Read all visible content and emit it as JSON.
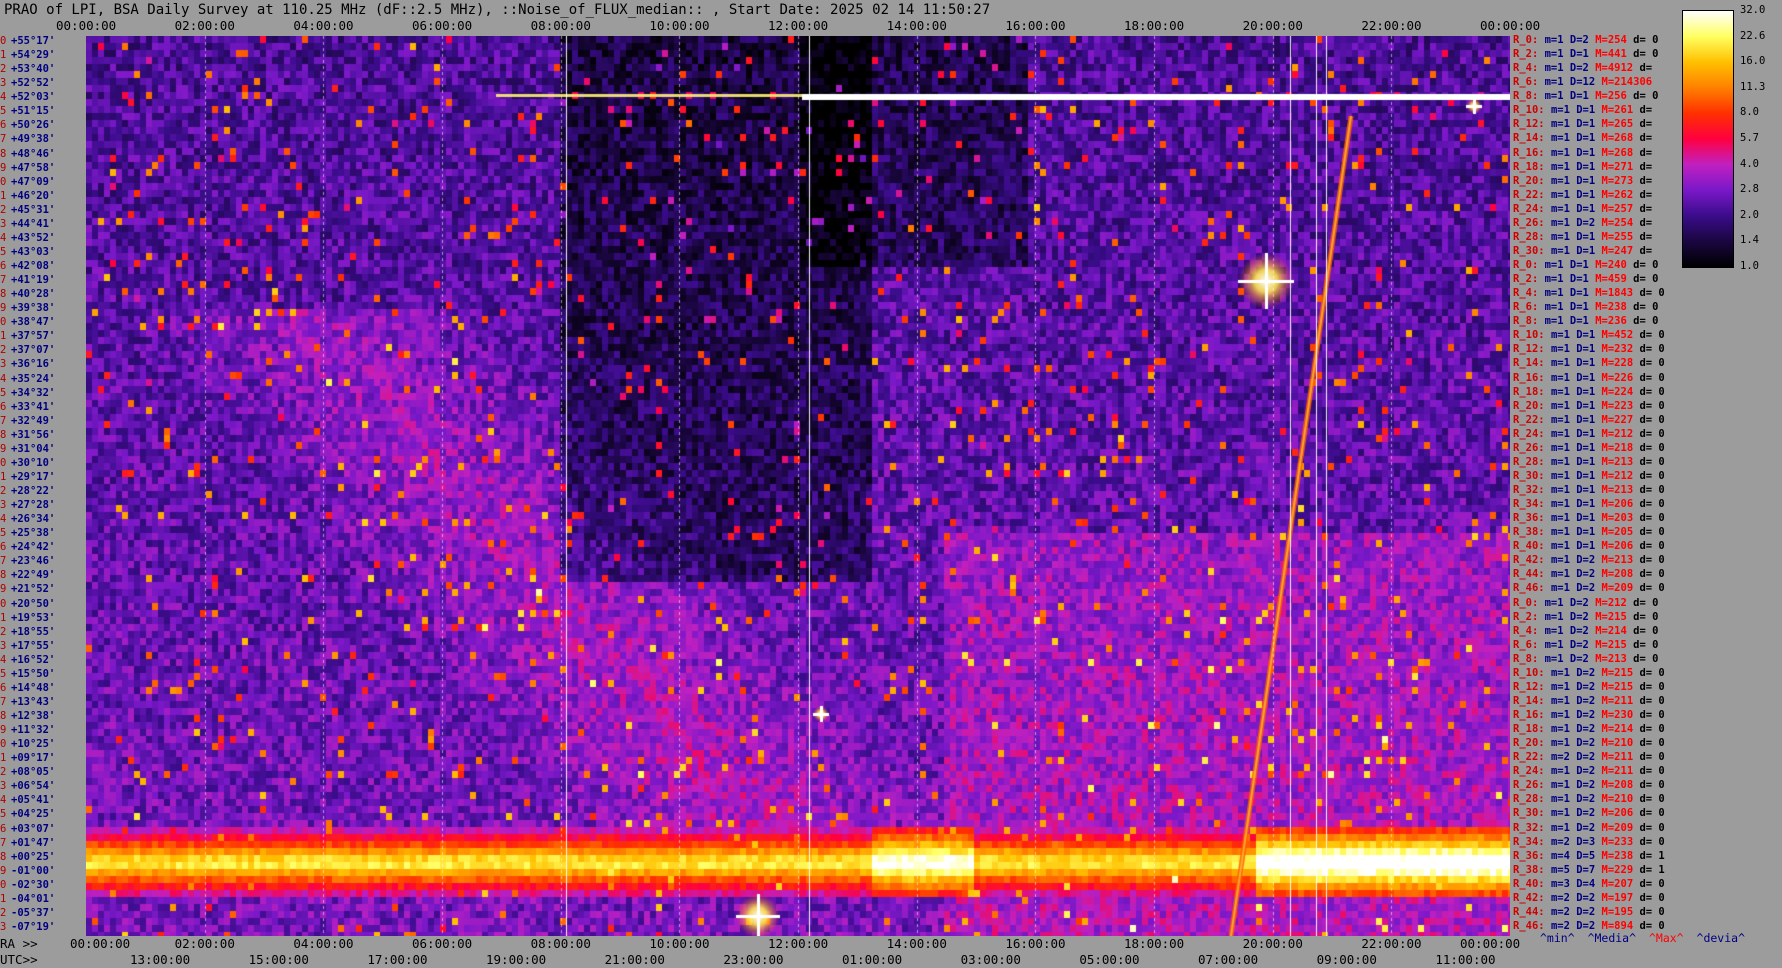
{
  "title": "PRAO of LPI, BSA Daily Survey at 110.25 MHz (dF::2.5 MHz), ::Noise_of_FLUX_median:: , Start Date: 2025 02 14 11:50:27",
  "chart_data": {
    "type": "heatmap",
    "title": "PRAO of LPI, BSA Daily Survey at 110.25 MHz (dF::2.5 MHz), ::Noise_of_FLUX_median:: , Start Date: 2025 02 14 11:50:27",
    "x_top_ticks": [
      "00:00:00",
      "02:00:00",
      "04:00:00",
      "06:00:00",
      "08:00:00",
      "10:00:00",
      "12:00:00",
      "14:00:00",
      "16:00:00",
      "18:00:00",
      "20:00:00",
      "22:00:00",
      "00:00:00"
    ],
    "ra_axis_label": "RA >>",
    "ra_ticks": [
      "00:00:00",
      "02:00:00",
      "04:00:00",
      "06:00:00",
      "08:00:00",
      "10:00:00",
      "12:00:00",
      "14:00:00",
      "16:00:00",
      "18:00:00",
      "20:00:00",
      "22:00:00",
      "00:00:00"
    ],
    "utc_axis_label": "UTC>>",
    "utc_ticks": [
      "13:00:00",
      "15:00:00",
      "17:00:00",
      "19:00:00",
      "21:00:00",
      "23:00:00",
      "01:00:00",
      "03:00:00",
      "05:00:00",
      "07:00:00",
      "09:00:00",
      "11:00:00"
    ],
    "dec_labels": [
      "+55°17'",
      "+54°29'",
      "+53°40'",
      "+52°52'",
      "+52°03'",
      "+51°15'",
      "+50°26'",
      "+49°38'",
      "+48°46'",
      "+47°58'",
      "+47°09'",
      "+46°20'",
      "+45°31'",
      "+44°41'",
      "+43°52'",
      "+43°03'",
      "+42°08'",
      "+41°19'",
      "+40°28'",
      "+39°38'",
      "+38°47'",
      "+37°57'",
      "+37°07'",
      "+36°16'",
      "+35°24'",
      "+34°32'",
      "+33°41'",
      "+32°49'",
      "+31°56'",
      "+31°04'",
      "+30°10'",
      "+29°17'",
      "+28°22'",
      "+27°28'",
      "+26°34'",
      "+25°38'",
      "+24°42'",
      "+23°46'",
      "+22°49'",
      "+21°52'",
      "+20°50'",
      "+19°53'",
      "+18°55'",
      "+17°55'",
      "+16°52'",
      "+15°50'",
      "+14°48'",
      "+13°43'",
      "+12°38'",
      "+11°32'",
      "+10°25'",
      "+09°17'",
      "+08°05'",
      "+06°54'",
      "+05°41'",
      "+04°25'",
      "+03°07'",
      "+01°47'",
      "+00°25'",
      "-01°00'",
      "-02°30'",
      "-04°01'",
      "-05°37'",
      "-07°19'"
    ],
    "colorbar": {
      "ticks": [
        "32.0",
        "22.6",
        "16.0",
        "11.3",
        "8.0",
        "5.7",
        "4.0",
        "2.8",
        "2.0",
        "1.4",
        "1.0"
      ],
      "colormap": [
        "#000000",
        "#1a0640",
        "#3a0c8a",
        "#7a18c8",
        "#c020c0",
        "#ff0040",
        "#ff3000",
        "#ff8000",
        "#ffc000",
        "#ffff60",
        "#ffffff"
      ]
    },
    "stat_rows": [
      {
        "r": "R_0:",
        "m": "m=1",
        "d": "D=2",
        "mx": "M=254",
        "dv": "d= 0"
      },
      {
        "r": "R_2:",
        "m": "m=1",
        "d": "D=1",
        "mx": "M=441",
        "dv": "d= 0"
      },
      {
        "r": "R_4:",
        "m": "m=1",
        "d": "D=2",
        "mx": "M=4912",
        "dv": "d="
      },
      {
        "r": "R_6:",
        "m": "m=1",
        "d": "D=12",
        "mx": "M=214306",
        "dv": ""
      },
      {
        "r": "R_8:",
        "m": "m=1",
        "d": "D=1",
        "mx": "M=256",
        "dv": "d= 0"
      },
      {
        "r": "R_10:",
        "m": "m=1",
        "d": "D=1",
        "mx": "M=261",
        "dv": "d="
      },
      {
        "r": "R_12:",
        "m": "m=1",
        "d": "D=1",
        "mx": "M=265",
        "dv": "d="
      },
      {
        "r": "R_14:",
        "m": "m=1",
        "d": "D=1",
        "mx": "M=268",
        "dv": "d="
      },
      {
        "r": "R_16:",
        "m": "m=1",
        "d": "D=1",
        "mx": "M=268",
        "dv": "d="
      },
      {
        "r": "R_18:",
        "m": "m=1",
        "d": "D=1",
        "mx": "M=271",
        "dv": "d="
      },
      {
        "r": "R_20:",
        "m": "m=1",
        "d": "D=1",
        "mx": "M=273",
        "dv": "d="
      },
      {
        "r": "R_22:",
        "m": "m=1",
        "d": "D=1",
        "mx": "M=262",
        "dv": "d="
      },
      {
        "r": "R_24:",
        "m": "m=1",
        "d": "D=1",
        "mx": "M=257",
        "dv": "d="
      },
      {
        "r": "R_26:",
        "m": "m=1",
        "d": "D=2",
        "mx": "M=254",
        "dv": "d="
      },
      {
        "r": "R_28:",
        "m": "m=1",
        "d": "D=1",
        "mx": "M=255",
        "dv": "d="
      },
      {
        "r": "R_30:",
        "m": "m=1",
        "d": "D=1",
        "mx": "M=247",
        "dv": "d="
      },
      {
        "r": "R_0:",
        "m": "m=1",
        "d": "D=1",
        "mx": "M=240",
        "dv": "d= 0"
      },
      {
        "r": "R_2:",
        "m": "m=1",
        "d": "D=1",
        "mx": "M=459",
        "dv": "d= 0"
      },
      {
        "r": "R_4:",
        "m": "m=1",
        "d": "D=1",
        "mx": "M=1843",
        "dv": "d= 0"
      },
      {
        "r": "R_6:",
        "m": "m=1",
        "d": "D=1",
        "mx": "M=238",
        "dv": "d= 0"
      },
      {
        "r": "R_8:",
        "m": "m=1",
        "d": "D=1",
        "mx": "M=236",
        "dv": "d= 0"
      },
      {
        "r": "R_10:",
        "m": "m=1",
        "d": "D=1",
        "mx": "M=452",
        "dv": "d= 0"
      },
      {
        "r": "R_12:",
        "m": "m=1",
        "d": "D=1",
        "mx": "M=232",
        "dv": "d= 0"
      },
      {
        "r": "R_14:",
        "m": "m=1",
        "d": "D=1",
        "mx": "M=228",
        "dv": "d= 0"
      },
      {
        "r": "R_16:",
        "m": "m=1",
        "d": "D=1",
        "mx": "M=226",
        "dv": "d= 0"
      },
      {
        "r": "R_18:",
        "m": "m=1",
        "d": "D=1",
        "mx": "M=224",
        "dv": "d= 0"
      },
      {
        "r": "R_20:",
        "m": "m=1",
        "d": "D=1",
        "mx": "M=223",
        "dv": "d= 0"
      },
      {
        "r": "R_22:",
        "m": "m=1",
        "d": "D=1",
        "mx": "M=227",
        "dv": "d= 0"
      },
      {
        "r": "R_24:",
        "m": "m=1",
        "d": "D=1",
        "mx": "M=212",
        "dv": "d= 0"
      },
      {
        "r": "R_26:",
        "m": "m=1",
        "d": "D=1",
        "mx": "M=218",
        "dv": "d= 0"
      },
      {
        "r": "R_28:",
        "m": "m=1",
        "d": "D=1",
        "mx": "M=213",
        "dv": "d= 0"
      },
      {
        "r": "R_30:",
        "m": "m=1",
        "d": "D=1",
        "mx": "M=212",
        "dv": "d= 0"
      },
      {
        "r": "R_32:",
        "m": "m=1",
        "d": "D=1",
        "mx": "M=213",
        "dv": "d= 0"
      },
      {
        "r": "R_34:",
        "m": "m=1",
        "d": "D=1",
        "mx": "M=206",
        "dv": "d= 0"
      },
      {
        "r": "R_36:",
        "m": "m=1",
        "d": "D=1",
        "mx": "M=203",
        "dv": "d= 0"
      },
      {
        "r": "R_38:",
        "m": "m=1",
        "d": "D=1",
        "mx": "M=205",
        "dv": "d= 0"
      },
      {
        "r": "R_40:",
        "m": "m=1",
        "d": "D=1",
        "mx": "M=206",
        "dv": "d= 0"
      },
      {
        "r": "R_42:",
        "m": "m=1",
        "d": "D=2",
        "mx": "M=213",
        "dv": "d= 0"
      },
      {
        "r": "R_44:",
        "m": "m=1",
        "d": "D=2",
        "mx": "M=208",
        "dv": "d= 0"
      },
      {
        "r": "R_46:",
        "m": "m=1",
        "d": "D=2",
        "mx": "M=209",
        "dv": "d= 0"
      },
      {
        "r": "R_0:",
        "m": "m=1",
        "d": "D=2",
        "mx": "M=212",
        "dv": "d= 0"
      },
      {
        "r": "R_2:",
        "m": "m=1",
        "d": "D=2",
        "mx": "M=215",
        "dv": "d= 0"
      },
      {
        "r": "R_4:",
        "m": "m=1",
        "d": "D=2",
        "mx": "M=214",
        "dv": "d= 0"
      },
      {
        "r": "R_6:",
        "m": "m=1",
        "d": "D=2",
        "mx": "M=215",
        "dv": "d= 0"
      },
      {
        "r": "R_8:",
        "m": "m=1",
        "d": "D=2",
        "mx": "M=213",
        "dv": "d= 0"
      },
      {
        "r": "R_10:",
        "m": "m=1",
        "d": "D=2",
        "mx": "M=215",
        "dv": "d= 0"
      },
      {
        "r": "R_12:",
        "m": "m=1",
        "d": "D=2",
        "mx": "M=215",
        "dv": "d= 0"
      },
      {
        "r": "R_14:",
        "m": "m=1",
        "d": "D=2",
        "mx": "M=211",
        "dv": "d= 0"
      },
      {
        "r": "R_16:",
        "m": "m=1",
        "d": "D=2",
        "mx": "M=230",
        "dv": "d= 0"
      },
      {
        "r": "R_18:",
        "m": "m=1",
        "d": "D=2",
        "mx": "M=214",
        "dv": "d= 0"
      },
      {
        "r": "R_20:",
        "m": "m=1",
        "d": "D=2",
        "mx": "M=210",
        "dv": "d= 0"
      },
      {
        "r": "R_22:",
        "m": "m=2",
        "d": "D=2",
        "mx": "M=211",
        "dv": "d= 0"
      },
      {
        "r": "R_24:",
        "m": "m=1",
        "d": "D=2",
        "mx": "M=211",
        "dv": "d= 0"
      },
      {
        "r": "R_26:",
        "m": "m=1",
        "d": "D=2",
        "mx": "M=208",
        "dv": "d= 0"
      },
      {
        "r": "R_28:",
        "m": "m=1",
        "d": "D=2",
        "mx": "M=210",
        "dv": "d= 0"
      },
      {
        "r": "R_30:",
        "m": "m=1",
        "d": "D=2",
        "mx": "M=206",
        "dv": "d= 0"
      },
      {
        "r": "R_32:",
        "m": "m=1",
        "d": "D=2",
        "mx": "M=209",
        "dv": "d= 0"
      },
      {
        "r": "R_34:",
        "m": "m=2",
        "d": "D=3",
        "mx": "M=233",
        "dv": "d= 0"
      },
      {
        "r": "R_36:",
        "m": "m=4",
        "d": "D=5",
        "mx": "M=238",
        "dv": "d= 1"
      },
      {
        "r": "R_38:",
        "m": "m=5",
        "d": "D=7",
        "mx": "M=229",
        "dv": "d= 1"
      },
      {
        "r": "R_40:",
        "m": "m=3",
        "d": "D=4",
        "mx": "M=207",
        "dv": "d= 0"
      },
      {
        "r": "R_42:",
        "m": "m=2",
        "d": "D=2",
        "mx": "M=197",
        "dv": "d= 0"
      },
      {
        "r": "R_44:",
        "m": "m=2",
        "d": "D=2",
        "mx": "M=195",
        "dv": "d= 0"
      },
      {
        "r": "R_46:",
        "m": "m=2",
        "d": "D=2",
        "mx": "M=894",
        "dv": "d= 0"
      }
    ],
    "footer_legend": {
      "min": "^min^",
      "media": "^Media^",
      "max": "^Max^",
      "devia": "^devia^"
    },
    "grid": true
  }
}
